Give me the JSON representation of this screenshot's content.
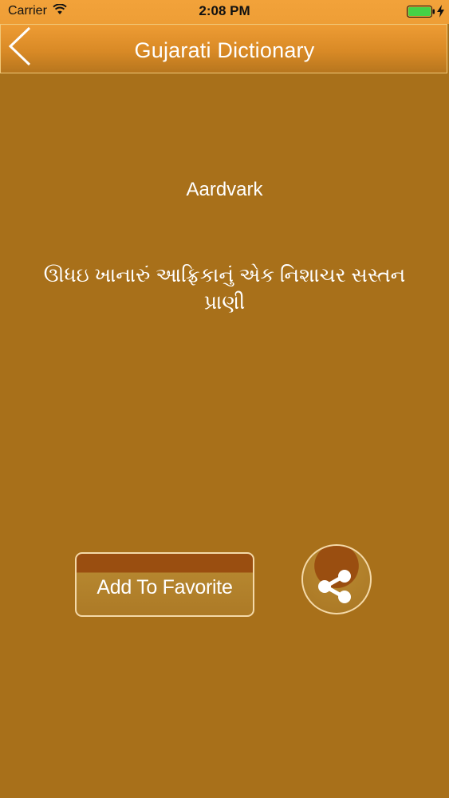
{
  "status_bar": {
    "carrier": "Carrier",
    "time": "2:08 PM",
    "wifi_icon": "wifi-icon",
    "battery_icon": "battery-icon",
    "charging_icon": "bolt-icon"
  },
  "nav": {
    "title": "Gujarati Dictionary",
    "back_icon": "chevron-left-icon"
  },
  "entry": {
    "word": "Aardvark",
    "meaning": "ઊધઇ ખાનારું આફ્રિકાનું એક નિશાચર સસ્તન પ્રાણી"
  },
  "actions": {
    "favorite_label": "Add To Favorite",
    "share_icon": "share-icon"
  },
  "colors": {
    "background": "#a8701a",
    "header": "#ee9c34",
    "button_dark": "#9a4e10",
    "border": "#f4d9a8"
  }
}
